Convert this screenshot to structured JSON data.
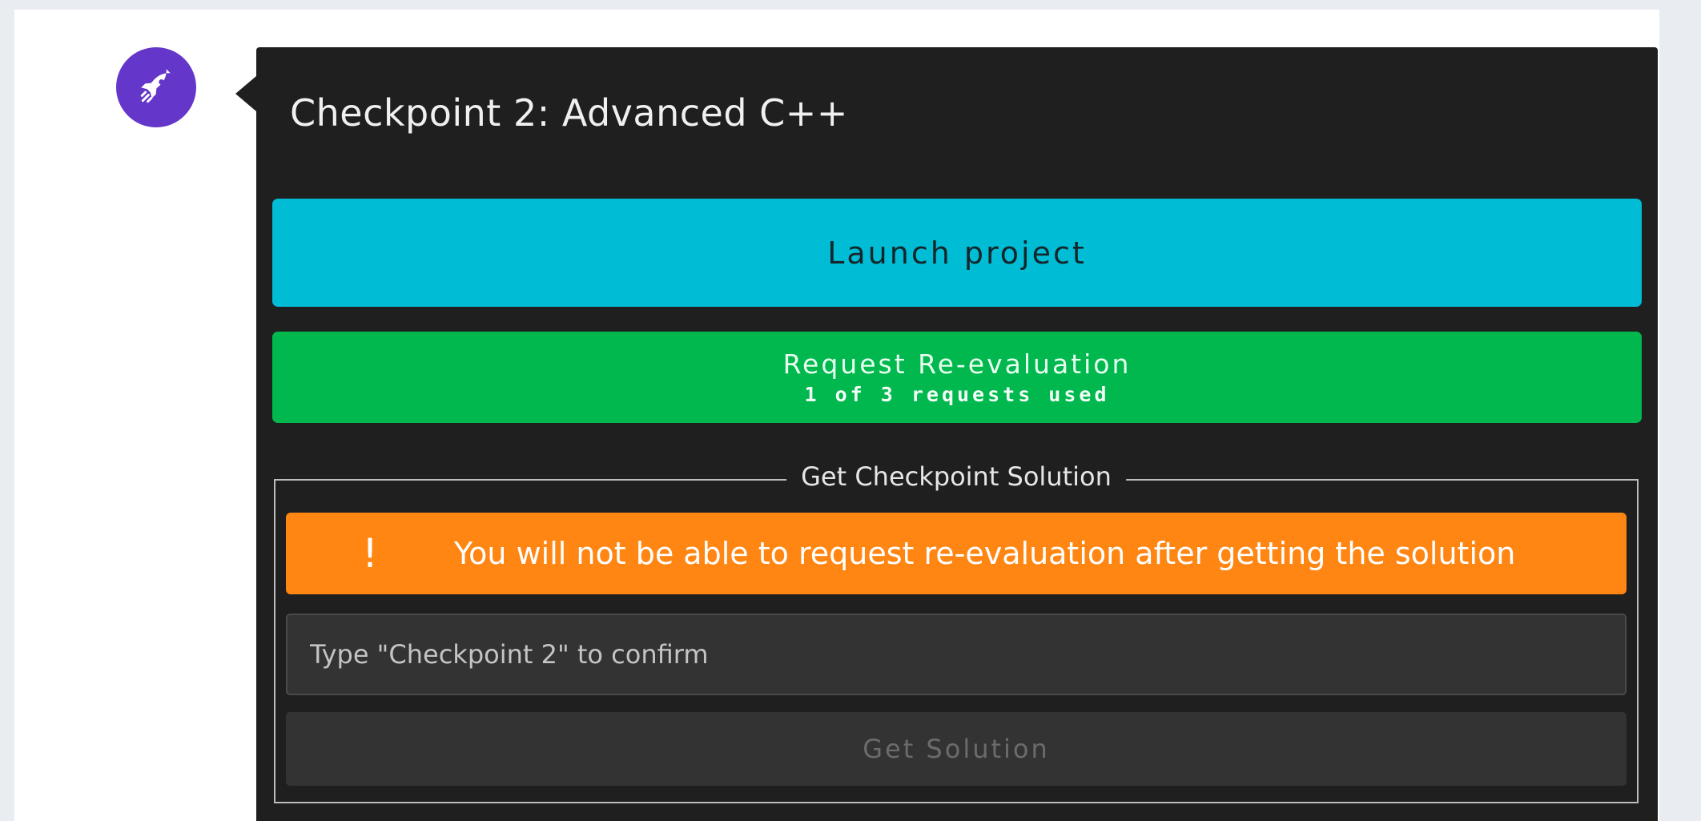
{
  "checkpoint": {
    "avatar_icon": "rocket-icon",
    "title": "Checkpoint 2: Advanced C++",
    "launch_button": "Launch project",
    "reevaluation": {
      "label": "Request Re-evaluation",
      "usage": "1 of 3 requests used"
    },
    "solution_section": {
      "legend": "Get Checkpoint Solution",
      "warning": {
        "icon": "!",
        "text": "You will not be able to request re-evaluation after getting the solution"
      },
      "confirm_input": {
        "value": "",
        "placeholder": "Type \"Checkpoint 2\" to confirm"
      },
      "button": "Get Solution"
    }
  },
  "colors": {
    "avatar": "#6436c9",
    "card_background": "#1f1f1f",
    "launch_button": "#00bcd4",
    "reevaluation_button": "#00b84e",
    "warning": "#ff8612",
    "disabled_button": "#333333"
  }
}
